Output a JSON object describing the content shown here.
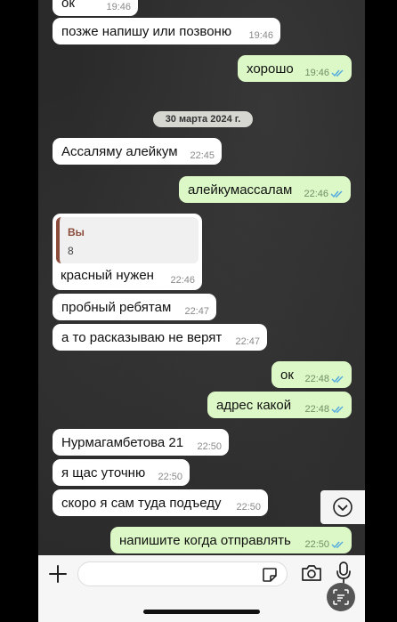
{
  "date_separator": "30 марта 2024 г.",
  "messages": [
    {
      "dir": "in",
      "text": "ок",
      "time": "19:46"
    },
    {
      "dir": "in",
      "text": "позже напишу или позвоню",
      "time": "19:46"
    },
    {
      "dir": "out",
      "text": "хорошо",
      "time": "19:46",
      "read": true
    },
    {
      "dir": "in",
      "text": "Ассаляму алейкум",
      "time": "22:45"
    },
    {
      "dir": "out",
      "text": "алейкумассалам",
      "time": "22:46",
      "read": true
    },
    {
      "dir": "in",
      "text": "красный нужен",
      "time": "22:46",
      "quote": {
        "author": "Вы",
        "text": "8"
      }
    },
    {
      "dir": "in",
      "text": "пробный ребятам",
      "time": "22:47"
    },
    {
      "dir": "in",
      "text": "а то расказываю не верят",
      "time": "22:47"
    },
    {
      "dir": "out",
      "text": "ок",
      "time": "22:48",
      "read": true
    },
    {
      "dir": "out",
      "text": "адрес какой",
      "time": "22:48",
      "read": true
    },
    {
      "dir": "in",
      "text": "Нурмагамбетова 21",
      "time": "22:50"
    },
    {
      "dir": "in",
      "text": "я щас уточню",
      "time": "22:50"
    },
    {
      "dir": "in",
      "text": "скоро я сам туда подъеду",
      "time": "22:50"
    },
    {
      "dir": "out",
      "text": "напишите когда отправлять",
      "time": "22:50",
      "read": true
    }
  ],
  "input": {
    "placeholder": ""
  },
  "icons": {
    "plus": "plus-icon",
    "sticker": "sticker-icon",
    "camera": "camera-icon",
    "mic": "microphone-icon",
    "scroll": "chevron-down-icon",
    "scan": "scan-text-icon"
  },
  "colors": {
    "incoming": "#ffffff",
    "outgoing": "#dcf8c6",
    "read_ticks": "#4fa8e0",
    "quote_bar": "#8b4c3c"
  }
}
